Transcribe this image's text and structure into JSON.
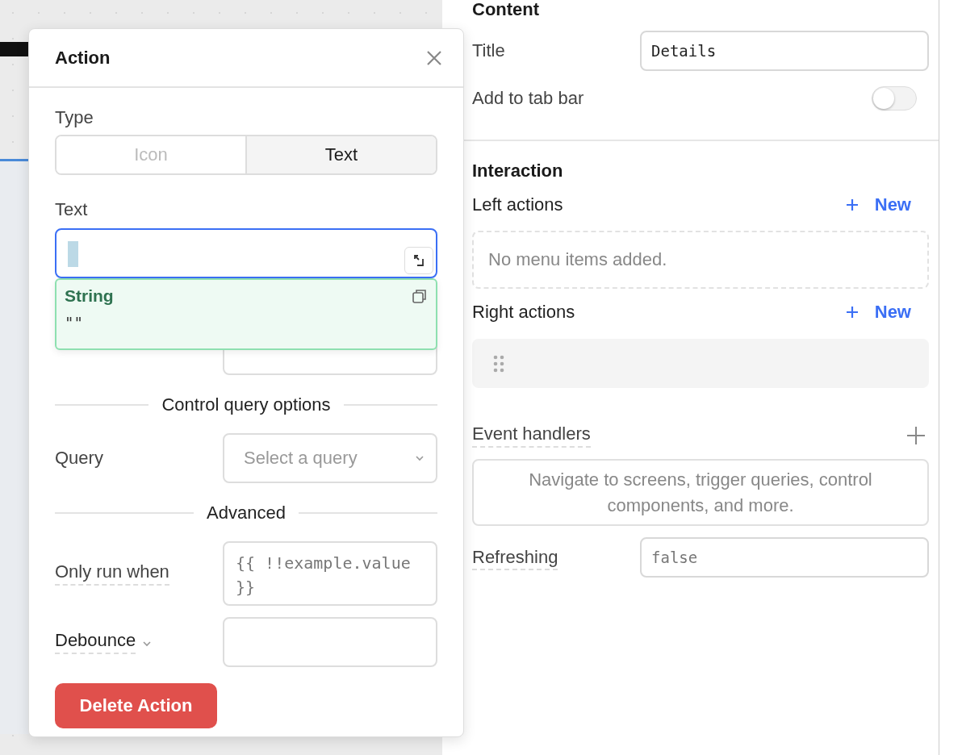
{
  "popover": {
    "title": "Action",
    "type_label": "Type",
    "type_options": [
      {
        "label": "Icon",
        "selected": false
      },
      {
        "label": "Text",
        "selected": true
      }
    ],
    "text_label": "Text",
    "text_field": {
      "focused": true
    },
    "suggestion": {
      "type": "String",
      "value": "\"\""
    },
    "query_section": "Control query options",
    "query_label": "Query",
    "query_select": {
      "placeholder": "Select a query"
    },
    "advanced_section": "Advanced",
    "only_run_label": "Only run when",
    "only_run_field": {
      "placeholder": "{{ !!example.value }}"
    },
    "debounce_label": "Debounce",
    "delete_button": "Delete Action"
  },
  "inspector": {
    "content_heading": "Content",
    "title_label": "Title",
    "title_value": "Details",
    "tab_bar_label": "Add to tab bar",
    "tab_bar_on": false,
    "interaction_heading": "Interaction",
    "left_actions": {
      "label": "Left actions",
      "new_button": "New",
      "empty_text": "No menu items added."
    },
    "right_actions": {
      "label": "Right actions",
      "new_button": "New",
      "items": [
        {
          "kind": "blank"
        }
      ]
    },
    "event_handlers": {
      "label": "Event handlers",
      "empty_text": "Navigate to screens, trigger queries, control components, and more."
    },
    "refreshing_label": "Refreshing",
    "refreshing_field": {
      "placeholder": "false"
    }
  }
}
